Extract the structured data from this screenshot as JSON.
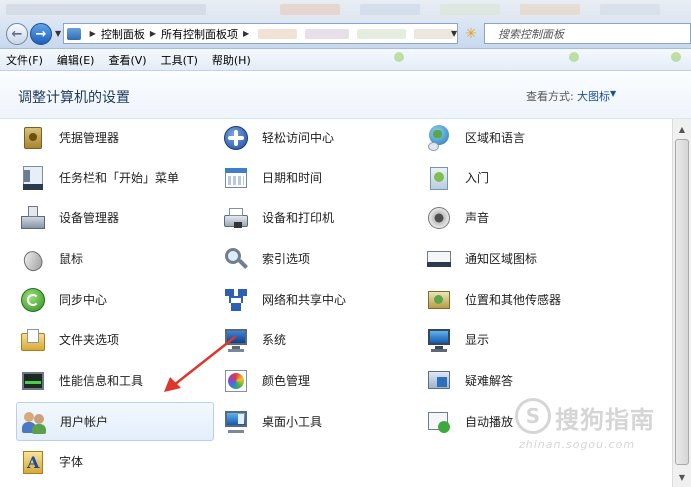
{
  "toolbar": {
    "crumbs": [
      "控制面板",
      "所有控制面板项"
    ],
    "search_placeholder": "搜索控制面板"
  },
  "menu": [
    "文件(F)",
    "编辑(E)",
    "查看(V)",
    "工具(T)",
    "帮助(H)"
  ],
  "header": {
    "title": "调整计算机的设置",
    "view_label": "查看方式:",
    "view_value": "大图标"
  },
  "items": [
    {
      "label": "凭据管理器",
      "icon": "credential-manager-icon"
    },
    {
      "label": "轻松访问中心",
      "icon": "ease-of-access-icon"
    },
    {
      "label": "区域和语言",
      "icon": "region-language-icon"
    },
    {
      "label": "任务栏和「开始」菜单",
      "icon": "taskbar-start-menu-icon"
    },
    {
      "label": "日期和时间",
      "icon": "date-time-icon"
    },
    {
      "label": "入门",
      "icon": "getting-started-icon"
    },
    {
      "label": "设备管理器",
      "icon": "device-manager-icon"
    },
    {
      "label": "设备和打印机",
      "icon": "devices-printers-icon"
    },
    {
      "label": "声音",
      "icon": "sound-icon"
    },
    {
      "label": "鼠标",
      "icon": "mouse-icon"
    },
    {
      "label": "索引选项",
      "icon": "indexing-options-icon"
    },
    {
      "label": "通知区域图标",
      "icon": "notification-area-icon"
    },
    {
      "label": "同步中心",
      "icon": "sync-center-icon"
    },
    {
      "label": "网络和共享中心",
      "icon": "network-sharing-icon"
    },
    {
      "label": "位置和其他传感器",
      "icon": "location-sensors-icon"
    },
    {
      "label": "文件夹选项",
      "icon": "folder-options-icon"
    },
    {
      "label": "系统",
      "icon": "system-icon"
    },
    {
      "label": "显示",
      "icon": "display-icon"
    },
    {
      "label": "性能信息和工具",
      "icon": "performance-tools-icon"
    },
    {
      "label": "颜色管理",
      "icon": "color-management-icon"
    },
    {
      "label": "疑难解答",
      "icon": "troubleshooting-icon"
    },
    {
      "label": "用户帐户",
      "icon": "user-accounts-icon",
      "selected": true
    },
    {
      "label": "桌面小工具",
      "icon": "desktop-gadgets-icon"
    },
    {
      "label": "自动播放",
      "icon": "autoplay-icon"
    },
    {
      "label": "字体",
      "icon": "fonts-icon"
    }
  ],
  "watermark": {
    "mark": "S",
    "text": "搜狗指南",
    "url": "zhinan.sogou.com"
  },
  "colors": {
    "annotation_arrow": "#e0352b",
    "title": "#1e395b",
    "link": "#1b4f96"
  }
}
